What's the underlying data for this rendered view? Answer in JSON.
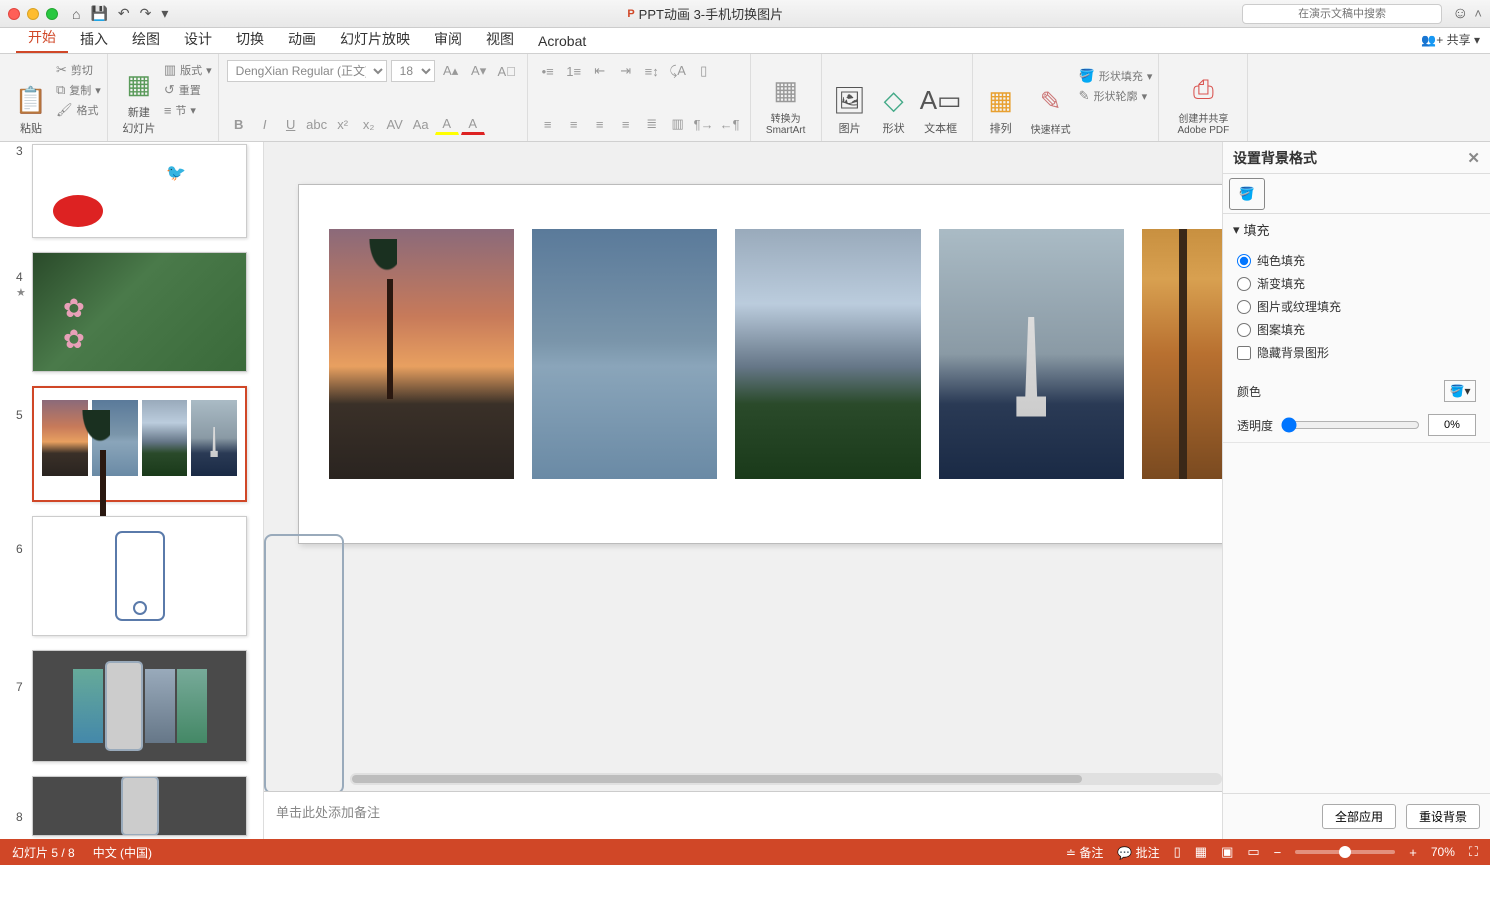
{
  "title": "PPT动画 3-手机切换图片",
  "search_placeholder": "在演示文稿中搜索",
  "share": "共享",
  "tabs": [
    "开始",
    "插入",
    "绘图",
    "设计",
    "切换",
    "动画",
    "幻灯片放映",
    "审阅",
    "视图",
    "Acrobat"
  ],
  "active_tab": "开始",
  "ribbon": {
    "paste": "粘贴",
    "cut": "剪切",
    "copy": "复制",
    "format": "格式",
    "newslide": "新建\n幻灯片",
    "layout": "版式",
    "reset": "重置",
    "section": "节",
    "font_name": "DengXian Regular (正文)",
    "font_size": "18",
    "smartart": "转换为\nSmartArt",
    "picture": "图片",
    "shapes": "形状",
    "textbox": "文本框",
    "arrange": "排列",
    "quickstyle": "快速样式",
    "shapefill": "形状填充",
    "shapeoutline": "形状轮廓",
    "createpdf": "创建并共享\nAdobe PDF"
  },
  "thumbs": {
    "n3": "3",
    "n4": "4",
    "n5": "5",
    "n6": "6",
    "n7": "7",
    "n8": "8"
  },
  "notes_placeholder": "单击此处添加备注",
  "pane": {
    "title": "设置背景格式",
    "fill_header": "填充",
    "solid": "纯色填充",
    "gradient": "渐变填充",
    "picture": "图片或纹理填充",
    "pattern": "图案填充",
    "hide": "隐藏背景图形",
    "color": "颜色",
    "transparency": "透明度",
    "tval": "0%",
    "apply_all": "全部应用",
    "reset": "重设背景"
  },
  "status": {
    "slide": "幻灯片 5 / 8",
    "lang": "中文 (中国)",
    "notes": "备注",
    "comments": "批注",
    "zoom": "70%"
  }
}
